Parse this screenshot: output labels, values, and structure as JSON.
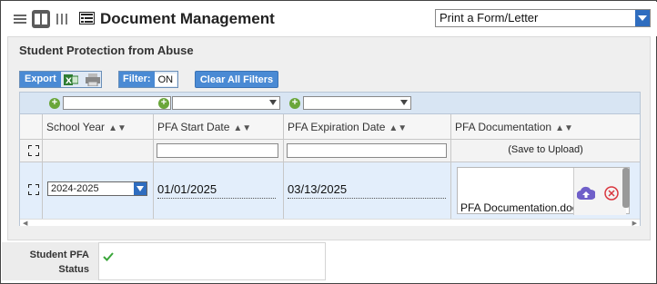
{
  "header": {
    "title": "Document Management",
    "action_select": "Print a Form/Letter"
  },
  "section": {
    "title": "Student Protection from Abuse"
  },
  "toolbar": {
    "export_label": "Export",
    "filter_label": "Filter:",
    "filter_value": "ON",
    "clear_filters_label": "Clear All Filters"
  },
  "table": {
    "columns": [
      {
        "label": "School Year"
      },
      {
        "label": "PFA Start Date"
      },
      {
        "label": "PFA Expiration Date"
      },
      {
        "label": "PFA Documentation"
      }
    ],
    "filter_row": {
      "documentation_hint": "(Save to Upload)"
    },
    "row": {
      "school_year": "2024-2025",
      "start_date": "01/01/2025",
      "expiration_date": "03/13/2025",
      "documentation_file": "PFA Documentation.docx"
    }
  },
  "student_pfa_status": {
    "label_line1": "Student PFA",
    "label_line2": "Status"
  },
  "colors": {
    "accent_blue": "#4a8ad4",
    "select_arrow_blue": "#2f6dbf",
    "row_highlight": "#e3eefb",
    "check_green": "#3aa63a"
  }
}
